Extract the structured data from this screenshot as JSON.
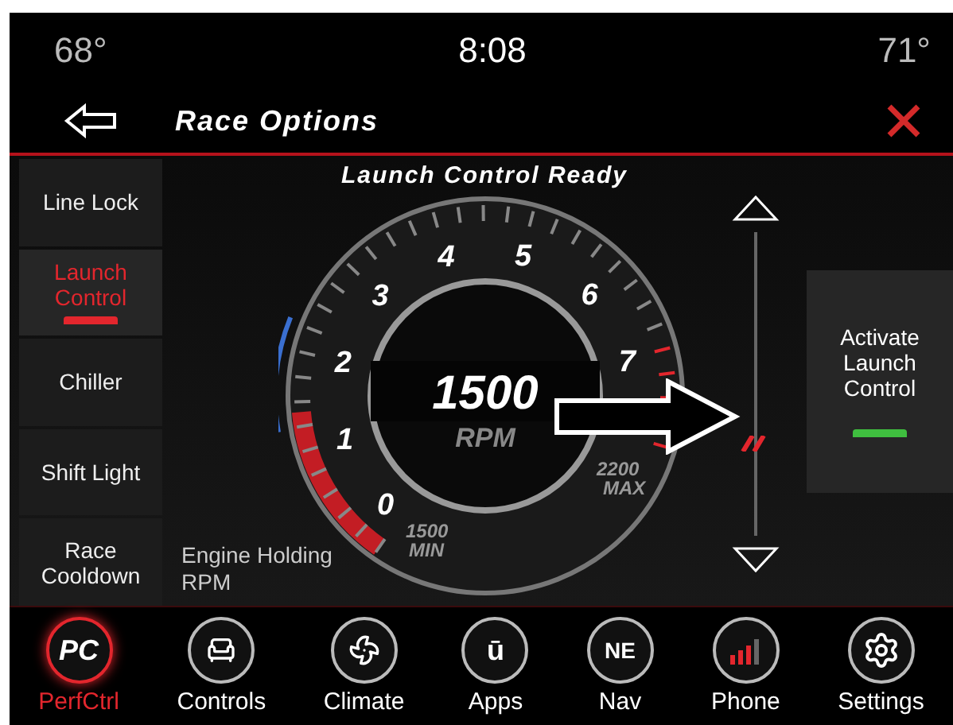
{
  "status_bar": {
    "left_temp": "68°",
    "time": "8:08",
    "right_temp": "71°"
  },
  "title_bar": {
    "title": "Race Options"
  },
  "sidebar": {
    "items": [
      {
        "label": "Line Lock",
        "selected": false
      },
      {
        "label": "Launch Control",
        "selected": true
      },
      {
        "label": "Chiller",
        "selected": false
      },
      {
        "label": "Shift Light",
        "selected": false
      },
      {
        "label": "Race Cooldown",
        "selected": false
      }
    ]
  },
  "gauge": {
    "heading": "Launch Control Ready",
    "scale": [
      "0",
      "1",
      "2",
      "3",
      "4",
      "5",
      "6",
      "7"
    ],
    "value": "1500",
    "unit": "RPM",
    "min": "1500",
    "min_label": "MIN",
    "max": "2200",
    "max_label": "MAX",
    "caption": "Engine Holding RPM"
  },
  "rpm_slider": {
    "level": 0.32
  },
  "activate_button": {
    "label": "Activate Launch Control",
    "on": true
  },
  "bottom_nav": [
    {
      "label": "PerfCtrl",
      "kind": "pc",
      "icon_text": "PC",
      "selected": true
    },
    {
      "label": "Controls",
      "kind": "seat",
      "selected": false
    },
    {
      "label": "Climate",
      "kind": "climate",
      "selected": false
    },
    {
      "label": "Apps",
      "kind": "apps",
      "icon_text": "ū",
      "selected": false
    },
    {
      "label": "Nav",
      "kind": "nav",
      "icon_text": "NE",
      "selected": false
    },
    {
      "label": "Phone",
      "kind": "phone",
      "selected": false
    },
    {
      "label": "Settings",
      "kind": "settings",
      "selected": false
    }
  ]
}
